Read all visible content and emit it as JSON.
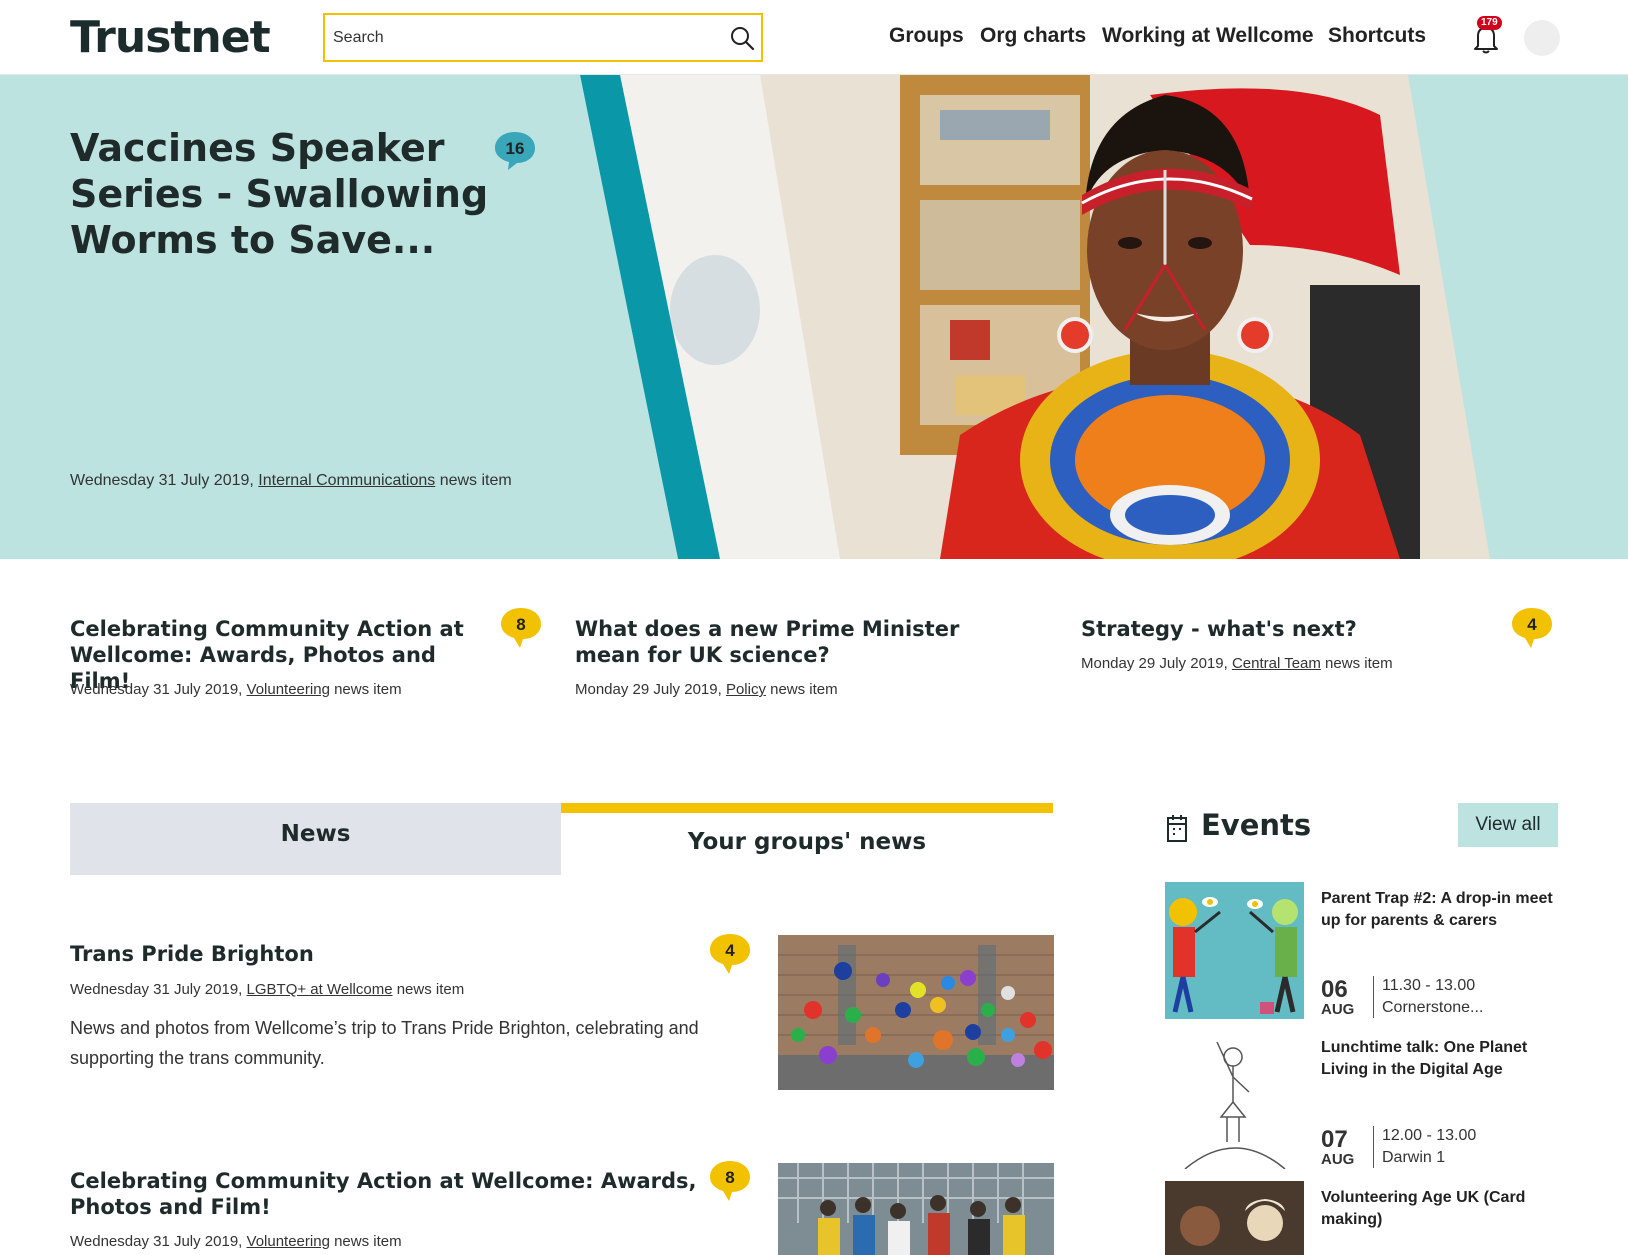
{
  "header": {
    "logo": "Trustnet",
    "search_placeholder": "Search",
    "nav": [
      "Groups",
      "Org charts",
      "Working at Wellcome",
      "Shortcuts"
    ],
    "notification_count": "179"
  },
  "hero": {
    "title": "Vaccines Speaker Series - Swallowing Worms to Save...",
    "comments": "16",
    "date": "Wednesday 31 July 2019,",
    "group": "Internal Communications",
    "suffix": "news item"
  },
  "featured": [
    {
      "title": "Celebrating Community Action at Wellcome: Awards, Photos and Film!",
      "comments": "8",
      "date": "Wednesday 31 July 2019,",
      "group": "Volunteering",
      "suffix": "news item"
    },
    {
      "title": "What does a new Prime Minister mean for UK science?",
      "date": "Monday 29 July 2019,",
      "group": "Policy",
      "suffix": "news item"
    },
    {
      "title": "Strategy - what's next?",
      "comments": "4",
      "date": "Monday 29 July 2019,",
      "group": "Central Team",
      "suffix": "news item"
    }
  ],
  "tabs": {
    "news": "News",
    "groups": "Your groups' news"
  },
  "articles": [
    {
      "title": "Trans Pride Brighton",
      "comments": "4",
      "date": "Wednesday 31 July 2019,",
      "group": "LGBTQ+ at Wellcome",
      "suffix": "news item",
      "summary": "News and photos from Wellcome’s trip to Trans Pride Brighton, celebrating and supporting the trans community."
    },
    {
      "title": "Celebrating Community Action at Wellcome: Awards, Photos and Film!",
      "comments": "8",
      "date": "Wednesday 31 July 2019,",
      "group": "Volunteering",
      "suffix": "news item"
    }
  ],
  "events": {
    "heading": "Events",
    "view_all": "View all",
    "items": [
      {
        "title": "Parent Trap #2: A drop-in meet up for parents & carers",
        "day": "06",
        "month": "AUG",
        "time": "11.30 - 13.00",
        "location": "Cornerstone..."
      },
      {
        "title": "Lunchtime talk: One Planet Living in the Digital Age",
        "day": "07",
        "month": "AUG",
        "time": "12.00 - 13.00",
        "location": "Darwin 1"
      },
      {
        "title": "Volunteering Age UK (Card making)"
      }
    ]
  },
  "colors": {
    "accent_yellow": "#f2c200",
    "hero_bg": "#bde3e1",
    "teal": "#0097a7",
    "tab_grey": "#e1e3ea",
    "badge_red": "#d0021b"
  }
}
